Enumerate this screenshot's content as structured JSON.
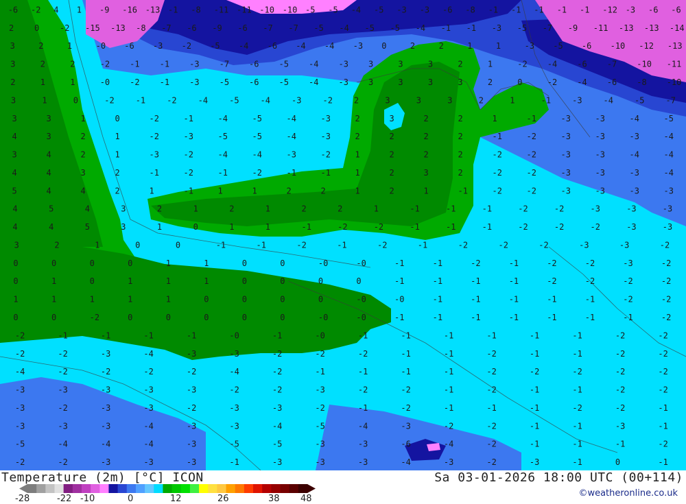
{
  "map": {
    "field_labels_note": "",
    "values": [
      [
        "-6",
        "-2",
        "4",
        "1",
        "-9",
        "-16",
        "-13",
        "-1",
        "-8",
        "-11",
        "-11",
        "-10",
        "-10",
        "-5",
        "-5",
        "-4",
        "-5",
        "-3",
        "-3",
        "-6",
        "-8",
        "-1",
        "-1",
        "-1",
        "-1",
        "-1",
        "-12",
        "-3",
        "-6",
        "-6"
      ],
      [
        "2",
        "0",
        "-2",
        "-15",
        "-13",
        "-8",
        "-7",
        "-6",
        "-9",
        "-6",
        "-7",
        "-7",
        "-5",
        "-4",
        "-5",
        "-5",
        "-4",
        "-1",
        "-1",
        "-3",
        "-5",
        "-7",
        "-9",
        "-11",
        "-13",
        "-13",
        "-14"
      ],
      [
        "3",
        "2",
        "1",
        "-0",
        "-6",
        "-3",
        "-2",
        "-5",
        "-4",
        "-6",
        "-4",
        "-4",
        "-3",
        "0",
        "2",
        "2",
        "1",
        "1",
        "-3",
        "-5",
        "-6",
        "-10",
        "-12",
        "-13"
      ],
      [
        "3",
        "2",
        "2",
        "-2",
        "-1",
        "-1",
        "-3",
        "-7",
        "-6",
        "-5",
        "-4",
        "-3",
        "3",
        "3",
        "3",
        "2",
        "1",
        "-2",
        "-4",
        "-6",
        "-7",
        "-10",
        "-11"
      ],
      [
        "2",
        "1",
        "1",
        "-0",
        "-2",
        "-1",
        "-3",
        "-5",
        "-6",
        "-5",
        "-4",
        "-3",
        "3",
        "3",
        "3",
        "3",
        "2",
        "0",
        "-2",
        "-4",
        "-6",
        "-8",
        "-10"
      ],
      [
        "3",
        "1",
        "0",
        "-2",
        "-1",
        "-2",
        "-4",
        "-5",
        "-4",
        "-3",
        "-2",
        "2",
        "3",
        "3",
        "3",
        "2",
        "1",
        "-1",
        "-3",
        "-4",
        "-5",
        "-7"
      ],
      [
        "3",
        "3",
        "1",
        "0",
        "-2",
        "-1",
        "-4",
        "-5",
        "-4",
        "-3",
        "2",
        "3",
        "2",
        "2",
        "1",
        "-1",
        "-3",
        "-3",
        "-4",
        "-5"
      ],
      [
        "4",
        "3",
        "2",
        "1",
        "-2",
        "-3",
        "-5",
        "-5",
        "-4",
        "-3",
        "2",
        "2",
        "2",
        "2",
        "-1",
        "-2",
        "-3",
        "-3",
        "-3",
        "-4"
      ],
      [
        "3",
        "4",
        "2",
        "1",
        "-3",
        "-2",
        "-4",
        "-4",
        "-3",
        "-2",
        "1",
        "2",
        "2",
        "2",
        "-2",
        "-2",
        "-3",
        "-3",
        "-4",
        "-4"
      ],
      [
        "4",
        "4",
        "3",
        "2",
        "-1",
        "-2",
        "-1",
        "-2",
        "-1",
        "-1",
        "1",
        "2",
        "3",
        "2",
        "-2",
        "-2",
        "-3",
        "-3",
        "-3",
        "-4"
      ],
      [
        "5",
        "4",
        "4",
        "2",
        "1",
        "-1",
        "1",
        "1",
        "2",
        "2",
        "1",
        "2",
        "1",
        "-1",
        "-2",
        "-2",
        "-3",
        "-3",
        "-3",
        "-3"
      ],
      [
        "4",
        "5",
        "4",
        "3",
        "2",
        "1",
        "2",
        "1",
        "2",
        "2",
        "1",
        "-1",
        "-1",
        "-1",
        "-2",
        "-2",
        "-3",
        "-3",
        "-3"
      ],
      [
        "4",
        "4",
        "5",
        "3",
        "1",
        "0",
        "1",
        "1",
        "-1",
        "-2",
        "-2",
        "-1",
        "-1",
        "-1",
        "-2",
        "-2",
        "-2",
        "-3",
        "-3"
      ],
      [
        "3",
        "2",
        "1",
        "0",
        "0",
        "-1",
        "-1",
        "-2",
        "-1",
        "-2",
        "-1",
        "-2",
        "-2",
        "-2",
        "-3",
        "-3",
        "-2"
      ],
      [
        "0",
        "0",
        "0",
        "0",
        "1",
        "1",
        "0",
        "0",
        "-0",
        "-0",
        "-1",
        "-1",
        "-2",
        "-1",
        "-2",
        "-2",
        "-3",
        "-2"
      ],
      [
        "0",
        "1",
        "0",
        "1",
        "1",
        "1",
        "0",
        "0",
        "0",
        "0",
        "-1",
        "-1",
        "-1",
        "-1",
        "-2",
        "-2",
        "-2",
        "-2"
      ],
      [
        "1",
        "1",
        "1",
        "1",
        "1",
        "0",
        "0",
        "0",
        "0",
        "-0",
        "-0",
        "-1",
        "-1",
        "-1",
        "-1",
        "-1",
        "-2",
        "-2"
      ],
      [
        "0",
        "0",
        "-2",
        "0",
        "0",
        "0",
        "0",
        "0",
        "-0",
        "-0",
        "-1",
        "-1",
        "-1",
        "-1",
        "-1",
        "-1",
        "-1",
        "-2"
      ],
      [
        "-2",
        "-1",
        "-1",
        "-1",
        "-1",
        "-0",
        "-1",
        "-0",
        "-1",
        "-1",
        "-1",
        "-1",
        "-1",
        "-1",
        "-2",
        "-2"
      ],
      [
        "-2",
        "-2",
        "-3",
        "-4",
        "-3",
        "-3",
        "-2",
        "-2",
        "-2",
        "-1",
        "-1",
        "-2",
        "-1",
        "-1",
        "-2",
        "-2"
      ],
      [
        "-4",
        "-2",
        "-2",
        "-2",
        "-2",
        "-4",
        "-2",
        "-1",
        "-1",
        "-1",
        "-1",
        "-2",
        "-2",
        "-2",
        "-2",
        "-2"
      ],
      [
        "-3",
        "-3",
        "-3",
        "-3",
        "-3",
        "-2",
        "-2",
        "-3",
        "-2",
        "-2",
        "-1",
        "-2",
        "-1",
        "-1",
        "-2",
        "-2"
      ],
      [
        "-3",
        "-2",
        "-3",
        "-3",
        "-2",
        "-3",
        "-3",
        "-2",
        "-1",
        "-2",
        "-1",
        "-1",
        "-1",
        "-2",
        "-2",
        "-1"
      ],
      [
        "-3",
        "-3",
        "-3",
        "-4",
        "-3",
        "-3",
        "-4",
        "-5",
        "-4",
        "-3",
        "-2",
        "-2",
        "-1",
        "-1",
        "-3",
        "-1"
      ],
      [
        "-5",
        "-4",
        "-4",
        "-4",
        "-3",
        "-5",
        "-5",
        "-3",
        "-3",
        "-6",
        "-4",
        "-2",
        "-1",
        "-1",
        "-1",
        "-2"
      ],
      [
        "-2",
        "-2",
        "-3",
        "-3",
        "-3",
        "-1",
        "-3",
        "-3",
        "-3",
        "-4",
        "-3",
        "-2",
        "-3",
        "-1",
        "0",
        "-1"
      ]
    ]
  },
  "footer": {
    "title": "Temperature (2m) [°C] ICON",
    "datetime": "Sa 03-01-2026 18:00 UTC (00+114)",
    "credit": "©weatheronline.co.uk",
    "colorbar": {
      "colors": [
        "#7d7d7d",
        "#a0a0a0",
        "#c3c3c3",
        "#e0e0e0",
        "#821e82",
        "#a030a0",
        "#c040c0",
        "#e060e0",
        "#ff80ff",
        "#1414a0",
        "#2846d2",
        "#3c78f0",
        "#50a0ff",
        "#64c8ff",
        "#00dcff",
        "#00aa00",
        "#00c800",
        "#00e000",
        "#40f040",
        "#ffff00",
        "#ffe040",
        "#ffc840",
        "#ffa000",
        "#ff7800",
        "#ff3c00",
        "#e01400",
        "#b40000",
        "#960000",
        "#780000",
        "#5a0000",
        "#3c0000"
      ],
      "tick_labels": [
        "-28",
        "-22",
        "-10",
        "0",
        "12",
        "26",
        "38",
        "48"
      ]
    }
  }
}
